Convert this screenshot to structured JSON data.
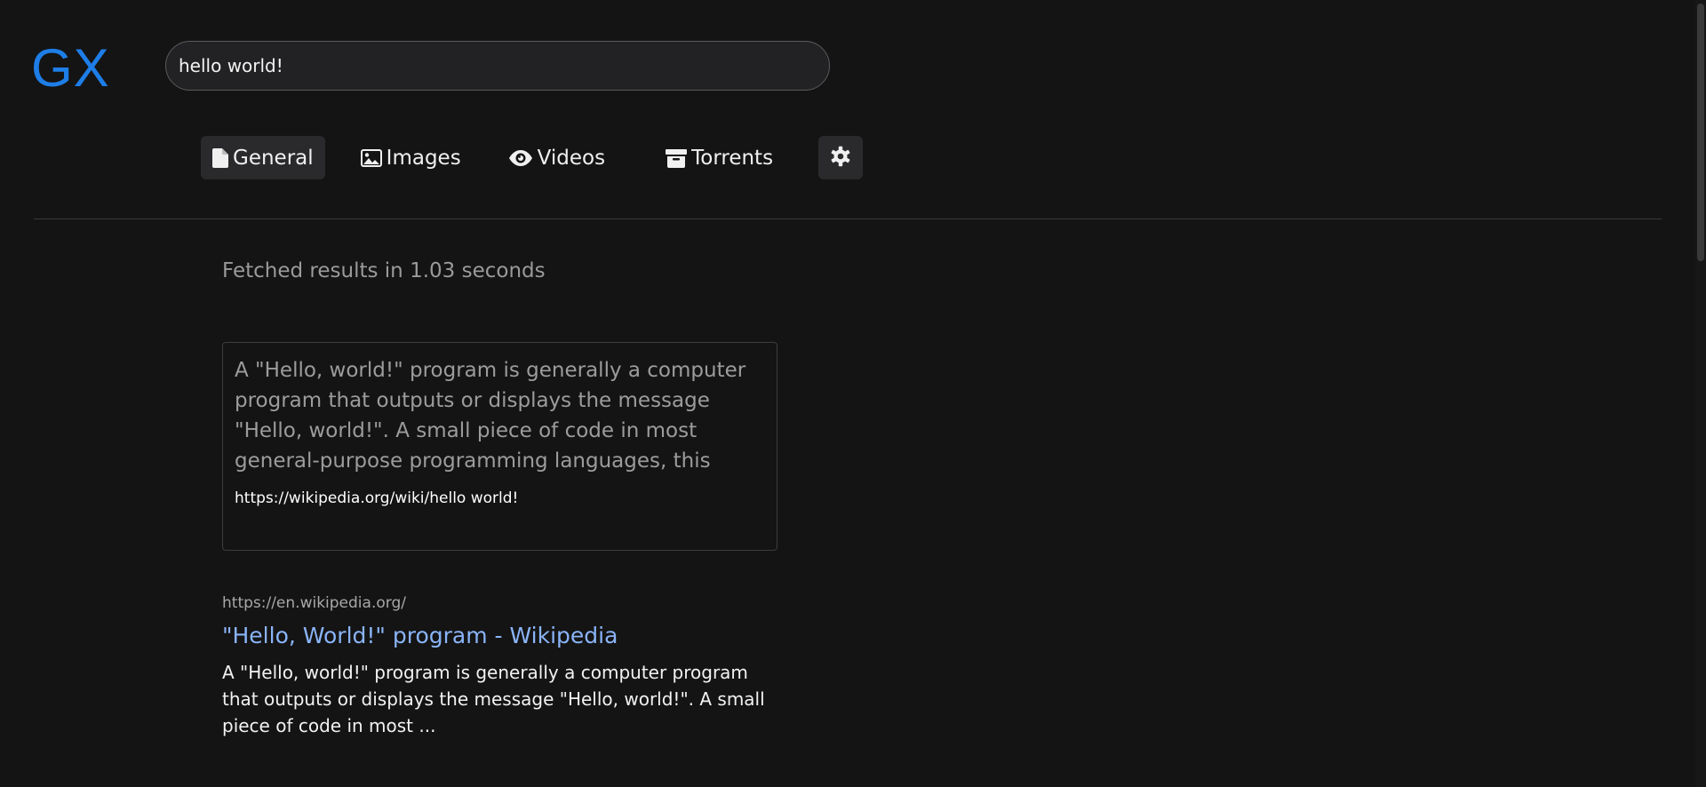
{
  "logo": "GX",
  "search": {
    "value": "hello world!"
  },
  "tabs": [
    {
      "label": "General",
      "icon": "file-icon",
      "active": true
    },
    {
      "label": "Images",
      "icon": "image-icon"
    },
    {
      "label": "Videos",
      "icon": "eye-icon"
    },
    {
      "label": "Torrents",
      "icon": "archive-icon"
    }
  ],
  "settings": {
    "icon": "gear-icon"
  },
  "fetch_info": "Fetched results in 1.03 seconds",
  "infobox": {
    "text": "A \"Hello, world!\" program is generally a computer program that outputs or displays the message \"Hello, world!\". A small piece of code in most general-purpose programming languages, this program is used to illustrate a language's basic syntax. \"Hello,...",
    "url": "https://wikipedia.org/wiki/hello world!"
  },
  "results": [
    {
      "url": "https://en.wikipedia.org/",
      "title": "\"Hello, World!\" program - Wikipedia",
      "snippet": "A \"Hello, world!\" program is generally a computer program that outputs or displays the message \"Hello, world!\". A small piece of code in most ..."
    }
  ],
  "colors": {
    "background": "#141414",
    "logo": "#1e7ee8",
    "link": "#8ab4f8"
  }
}
